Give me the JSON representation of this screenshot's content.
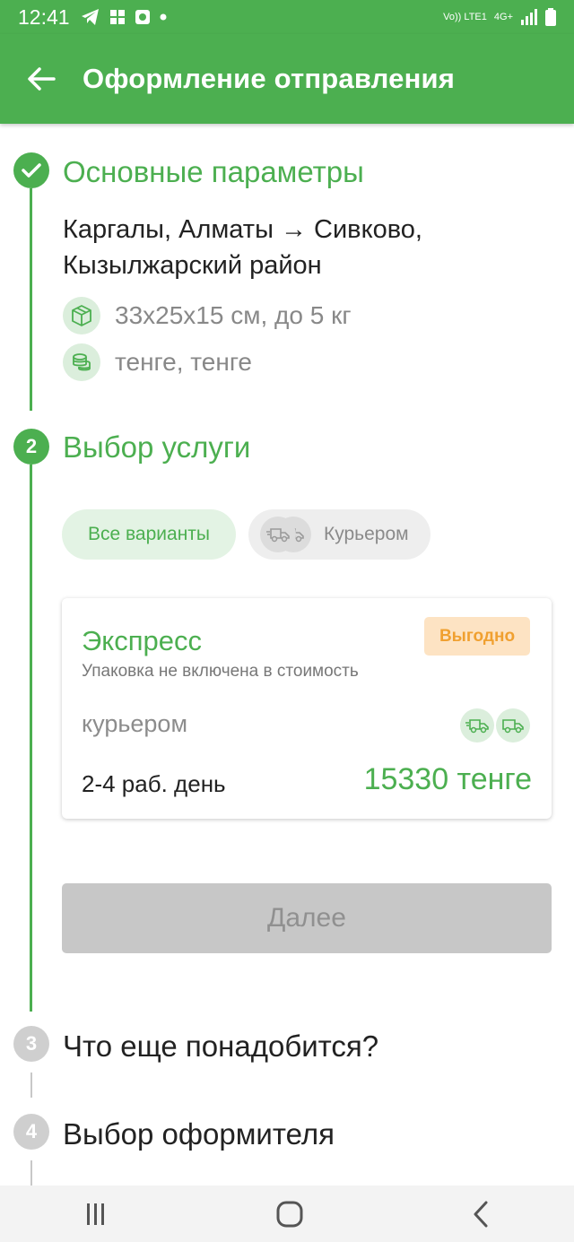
{
  "status_bar": {
    "time": "12:41",
    "network_label": "Vo)) LTE1",
    "network_type": "4G+",
    "icons": [
      "telegram-icon",
      "apps-icon",
      "camera-icon",
      "dot-icon",
      "signal-icon",
      "battery-icon"
    ]
  },
  "app_bar": {
    "title": "Оформление отправления",
    "back_icon": "arrow-left-icon"
  },
  "steps": [
    {
      "title": "Основные параметры",
      "state": "done",
      "route": "Каргалы, Алматы → Сивково, Кызылжарский район",
      "dimensions": "33x25x15 см, до 5 кг",
      "currency": "тенге, тенге"
    },
    {
      "number": "2",
      "title": "Выбор услуги",
      "state": "active",
      "filters": {
        "all": "Все варианты",
        "courier": "Курьером"
      },
      "offer": {
        "name": "Экспресс",
        "note": "Упаковка не включена в стоимость",
        "badge": "Выгодно",
        "method": "курьером",
        "days": "2-4 раб. день",
        "price": "15330 тенге"
      },
      "next_button": "Далее"
    },
    {
      "number": "3",
      "title": "Что еще понадобится?",
      "state": "pending"
    },
    {
      "number": "4",
      "title": "Выбор оформителя",
      "state": "pending"
    }
  ],
  "colors": {
    "primary": "#4caf50",
    "badge_bg": "#fde3c3",
    "badge_text": "#f0a030",
    "disabled_button": "#c7c7c7"
  }
}
